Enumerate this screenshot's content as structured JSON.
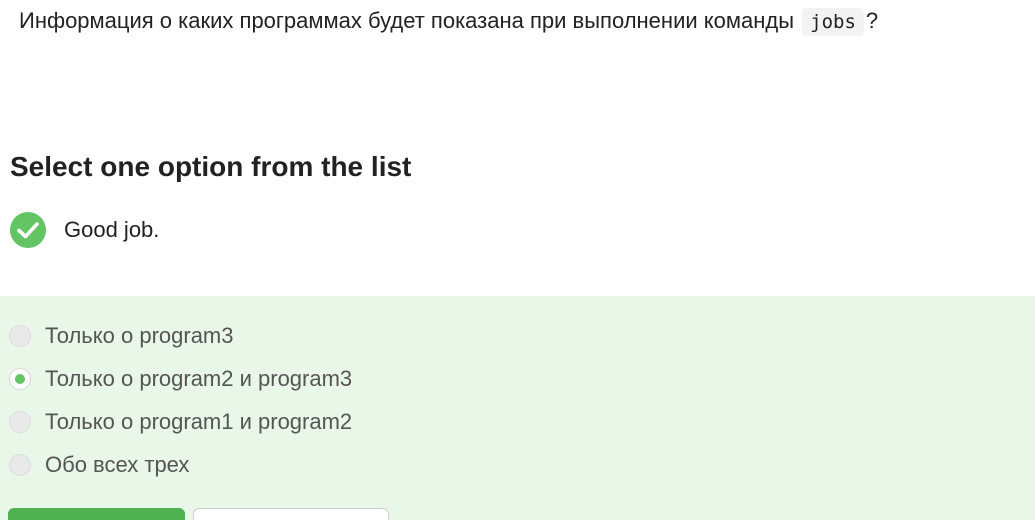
{
  "question": {
    "text": "Информация о каких программах будет показана при выполнении команды",
    "code": "jobs",
    "suffix": "?"
  },
  "prompt": {
    "title": "Select one option from the list"
  },
  "feedback": {
    "icon": "check-icon",
    "text": "Good job.",
    "color": "#62c462"
  },
  "options": [
    {
      "label": "Только о program3",
      "selected": false
    },
    {
      "label": "Только о program2 и program3",
      "selected": true
    },
    {
      "label": "Только о program1 и program2",
      "selected": false
    },
    {
      "label": "Обо всех трех",
      "selected": false
    }
  ],
  "colors": {
    "success": "#62c462",
    "panel_background": "#e8f7e8",
    "primary_button": "#4fb14f"
  }
}
